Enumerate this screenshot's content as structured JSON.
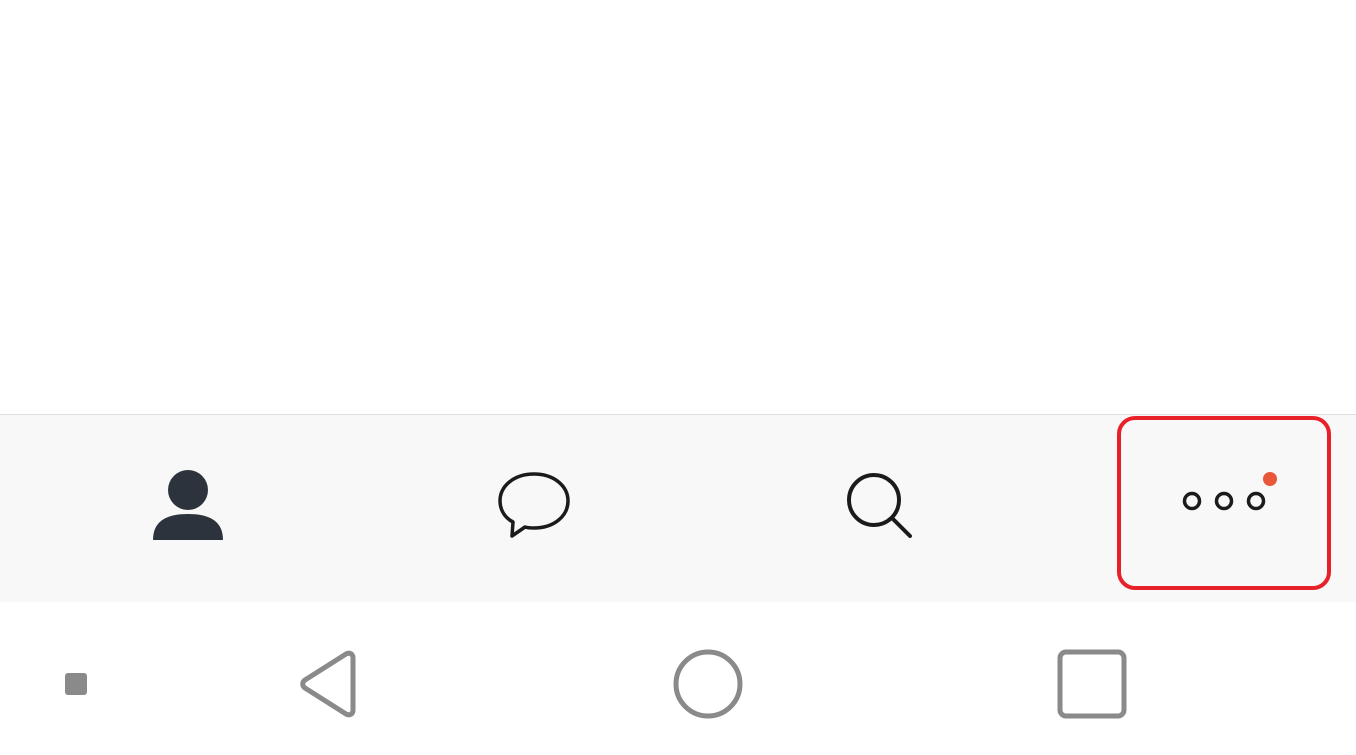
{
  "colors": {
    "tab_bar_background": "#f8f8f8",
    "icon_dark": "#2d333d",
    "icon_outline": "#1b1b1b",
    "badge": "#e8573a",
    "highlight_border": "#e8202a",
    "nav_icon": "#8a8a8a"
  },
  "tab_bar": {
    "tabs": [
      {
        "id": "contacts",
        "icon": "person-icon"
      },
      {
        "id": "chats",
        "icon": "chat-bubble-icon"
      },
      {
        "id": "search",
        "icon": "search-icon"
      },
      {
        "id": "more",
        "icon": "more-dots-icon",
        "has_badge": true,
        "highlighted": true
      }
    ]
  },
  "nav_bar": {
    "buttons": [
      {
        "id": "small",
        "icon": "small-square-icon"
      },
      {
        "id": "back",
        "icon": "back-triangle-icon"
      },
      {
        "id": "home",
        "icon": "home-circle-icon"
      },
      {
        "id": "recents",
        "icon": "recents-square-icon"
      }
    ]
  }
}
